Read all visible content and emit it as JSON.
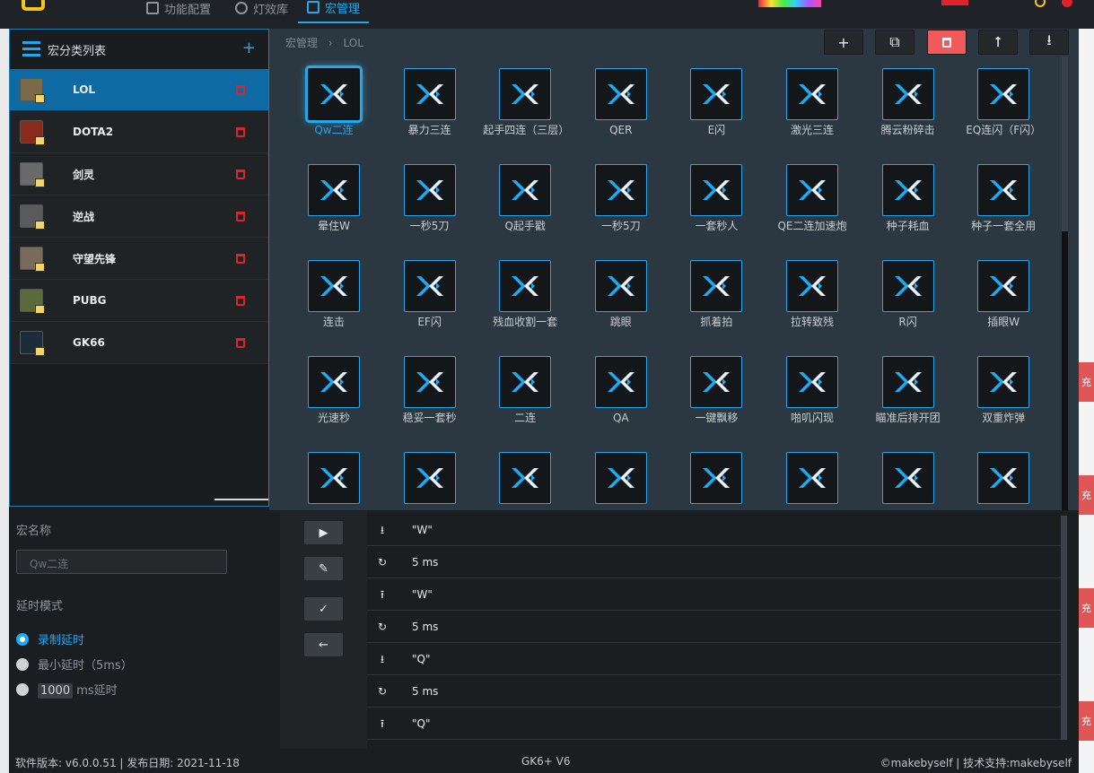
{
  "nav": {
    "items": [
      "功能配置",
      "灯效库",
      "宏管理"
    ],
    "active_index": 2
  },
  "sidebar": {
    "title": "宏分类列表",
    "add_label": "+",
    "items": [
      {
        "label": "LOL",
        "active": true
      },
      {
        "label": "DOTA2"
      },
      {
        "label": "剑灵"
      },
      {
        "label": "逆战"
      },
      {
        "label": "守望先锋"
      },
      {
        "label": "PUBG"
      },
      {
        "label": "GK66"
      }
    ]
  },
  "breadcrumb": {
    "root": "宏管理",
    "separator": "›",
    "current": "LOL"
  },
  "toolbar": {
    "add": "+",
    "copy": "⧉",
    "delete": "🗑",
    "upload": "⭡",
    "download": "⭳"
  },
  "macros": [
    "Qw二连",
    "暴力三连",
    "起手四连（三层）",
    "QER",
    "E闪",
    "激光三连",
    "腾云粉碎击",
    "EQ连闪（F闪）",
    "晕住W",
    "一秒5刀",
    "Q起手戳",
    "一秒5刀",
    "一套秒人",
    "QE二连加速炮",
    "种子耗血",
    "种子一套全用",
    "连击",
    "EF闪",
    "残血收割一套",
    "跳眼",
    "抓着拍",
    "拉转致残",
    "R闪",
    "插眼W",
    "光速秒",
    "稳妥一套秒",
    "二连",
    "QA",
    "一键飘移",
    "啪叽闪现",
    "瞄准后排开团",
    "双重炸弹",
    "",
    "",
    "",
    "",
    "",
    "",
    "",
    ""
  ],
  "editor": {
    "name_label": "宏名称",
    "name_value": "Qw二连",
    "delay_label": "延时模式",
    "options": [
      {
        "label": "录制延时",
        "checked": true
      },
      {
        "label": "最小延时（5ms）",
        "checked": false
      }
    ],
    "custom_delay_value": "1000",
    "custom_delay_unit": "ms延时"
  },
  "controls": {
    "play": "▶",
    "edit": "✎",
    "confirm": "✓",
    "back": "←"
  },
  "steps": [
    {
      "icon": "down-arrow",
      "text": "\"W\""
    },
    {
      "icon": "clock",
      "text": "5 ms"
    },
    {
      "icon": "up-arrow",
      "text": "\"W\""
    },
    {
      "icon": "clock",
      "text": "5 ms"
    },
    {
      "icon": "down-arrow",
      "text": "\"Q\""
    },
    {
      "icon": "clock",
      "text": "5 ms"
    },
    {
      "icon": "up-arrow",
      "text": "\"Q\""
    }
  ],
  "footer": {
    "version": "软件版本: v6.0.0.51 | 发布日期: 2021-11-18",
    "device": "GK6+ V6",
    "copyright": "©makebyself | 技术支持:makebyself"
  },
  "colors": {
    "accent": "#1fa9f0",
    "danger": "#e0222a",
    "active_row": "#0f6aa3"
  }
}
